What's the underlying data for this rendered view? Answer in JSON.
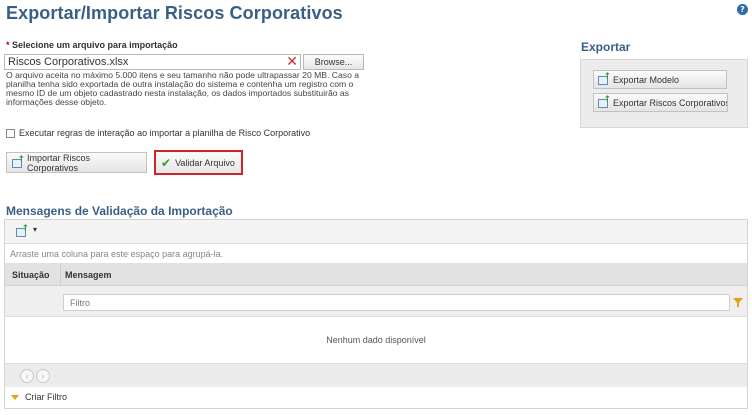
{
  "page": {
    "title": "Exportar/Importar Riscos Corporativos",
    "help_glyph": "?"
  },
  "import": {
    "required_mark": "*",
    "field_label": "Selecione um arquivo para importação",
    "file_value": "Riscos Corporativos.xlsx",
    "clear_glyph": "✕",
    "browse_label": "Browse...",
    "help_text": "O arquivo aceita no máximo 5.000 itens e seu tamanho não pode ultrapassar 20 MB. Caso a planilha tenha sido exportada de outra instalação do sistema e contenha um registro com o mesmo ID de um objeto cadastrado nesta instalação, os dados importados substituirão as informações desse objeto.",
    "checkbox_label": "Executar regras de interação ao importar a planilha de Risco Corporativo",
    "checkbox_checked": false,
    "import_button": "Importar Riscos Corporativos",
    "validate_button": "Validar Arquivo",
    "validate_icon": "checkmark-icon"
  },
  "export": {
    "heading": "Exportar",
    "model_button": "Exportar Modelo",
    "risks_button": "Exportar Riscos Corporativos"
  },
  "validation": {
    "heading": "Mensagens de Validação da Importação",
    "group_hint": "Arraste uma coluna para este espaço para agrupá-la.",
    "columns": [
      "Situação",
      "Mensagem"
    ],
    "filter_placeholder": "Filtro",
    "no_data": "Nenhum dado disponível",
    "create_filter": "Criar Filtro",
    "toolbar_caret": "▾",
    "pager_prev": "‹",
    "pager_next": "›"
  },
  "colors": {
    "title_blue": "#3a5f87",
    "highlight_red": "#d1232a",
    "clear_red": "#d0312d",
    "check_green": "#3a9b2c",
    "filter_orange": "#e4a21a"
  }
}
